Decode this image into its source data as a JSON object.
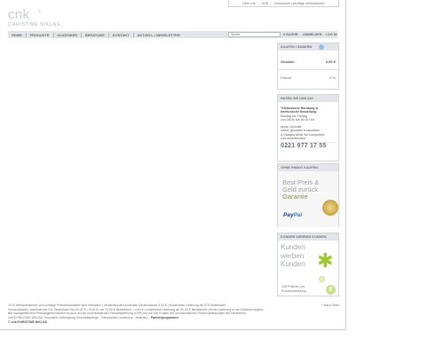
{
  "brand": {
    "logo_word": "cnk",
    "logo_star": "*",
    "logo_sub": "CHRISTINE NIKLAS"
  },
  "toplinks": [
    "Über cnk",
    "AGB",
    "Impressum | wichtige Informationen"
  ],
  "nav": {
    "items": [
      "HOME",
      "PRODUKTE",
      "KLASSIKER",
      "BERATUNG",
      "KONTAKT",
      "AKTUELL / NEWSLETTER"
    ],
    "search_placeholder": "Suche",
    "search_button": "// SUCHE",
    "register": "ANMELDEN",
    "login": "LOG IN"
  },
  "cart": {
    "heading": "KAUFEN / ÄNDERN",
    "total_label": "Gesamt:",
    "total_value": "0,00 €",
    "rabatt_label": "Rabatt",
    "rabatt_value": "0 %"
  },
  "advice": {
    "heading": "RATEN SIE UNS AN!",
    "line1": "Telefonische Beratung &",
    "line2": "telefonische Bestellung",
    "line3": "Montag bis Freitag",
    "line4": "von 08:00 bis 16:00 Uhr",
    "line5": "Anton Schmidt",
    "line6": "erteilt, geprüfter Kosmetiker",
    "line7": "& Visagist berät Sie kompetent",
    "line8": "und unverbindlich",
    "phone": "0221 977 17 55"
  },
  "noreg": {
    "heading": "OHNE RISIKO KAUFEN",
    "best1": "Best Preis &",
    "best2": "Geld zurück",
    "garantie": "Garantie",
    "paypal_pay": "Pay",
    "paypal_pal": "Pal"
  },
  "kunden": {
    "heading": "KUNDEN WERBEN KUNDEN",
    "line1": "Kunden",
    "line2": "werben",
    "line3": "Kunden",
    "small1": "10€ Prämie pro",
    "small2": "Kundenwerbung",
    "euro": "€"
  },
  "footer": {
    "line1": "19 % Mehrwertsteuer und sonstige Preisbestandteile sind enthalten | Versandkosten innerhalb Deutschlands 4,10 € | Kostenlose Lieferung ab 32 € Bestellwert",
    "line2": "Versandkosten innerhalb der EU: Bestellwert bis 60,00 € = 8,00 € | ab 70,00 € Bestellwert = 4,60 € | Kostenlose Lieferung ab 90,00 € Bestellwert | Keine Lieferung in die Schweiz möglich",
    "line3": "Bei nachgefallenem Preisangebot handelt es sich um die unverbindlichen Preisempfehlung (UVP) bis von der Kosten der unverbindlichen Preisempfehlungen der Herstellers",
    "line4": "cnk*CHRISTINE NIKLAS, Innovative Anfertigung Geschäftspflege - Handwerker, kostenlos - bestellen - ",
    "partner": "Partnerprogramme",
    "copyright": "© cnk*CHRISTINE NIKLAS",
    "top_link": "^ Nach Oben"
  }
}
